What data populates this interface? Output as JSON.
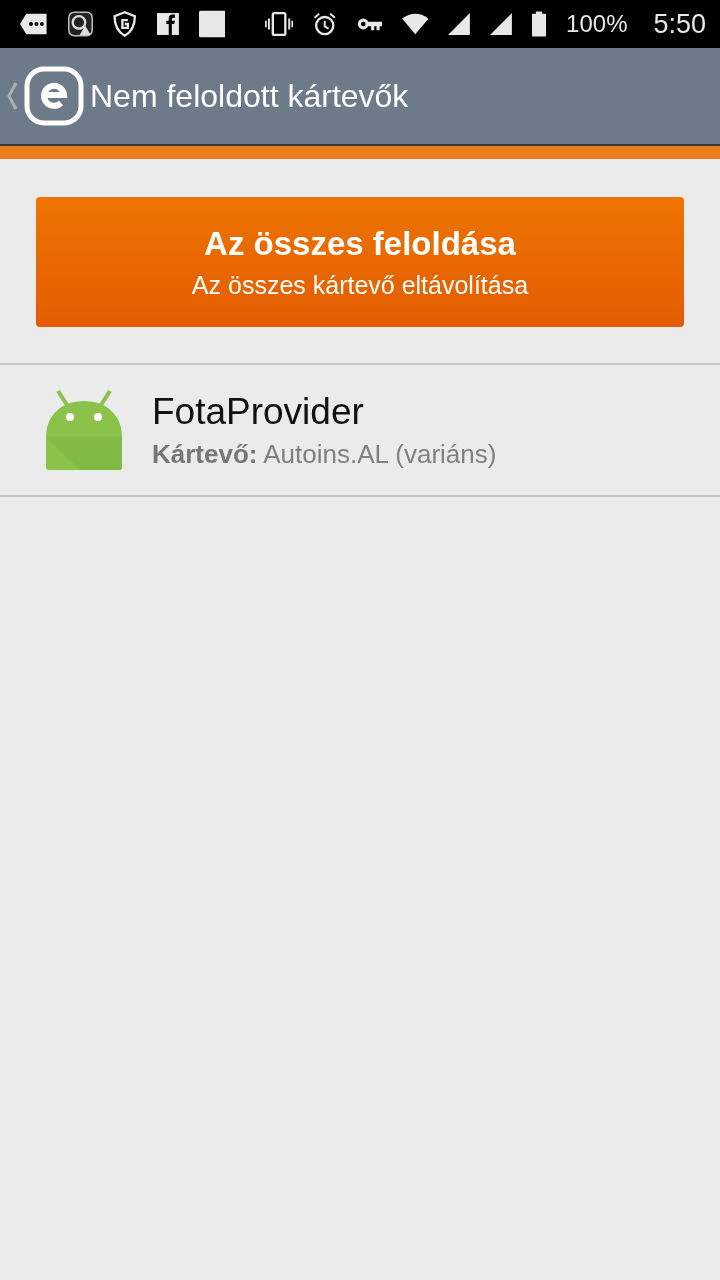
{
  "status_bar": {
    "battery": "100%",
    "time": "5:50"
  },
  "app_bar": {
    "title": "Nem feloldott kártevők"
  },
  "action_button": {
    "title": "Az összes feloldása",
    "subtitle": "Az összes kártevő eltávolítása"
  },
  "threats": [
    {
      "name": "FotaProvider",
      "detail": "**Kártevő:** Autoins.AL (variáns)"
    }
  ]
}
